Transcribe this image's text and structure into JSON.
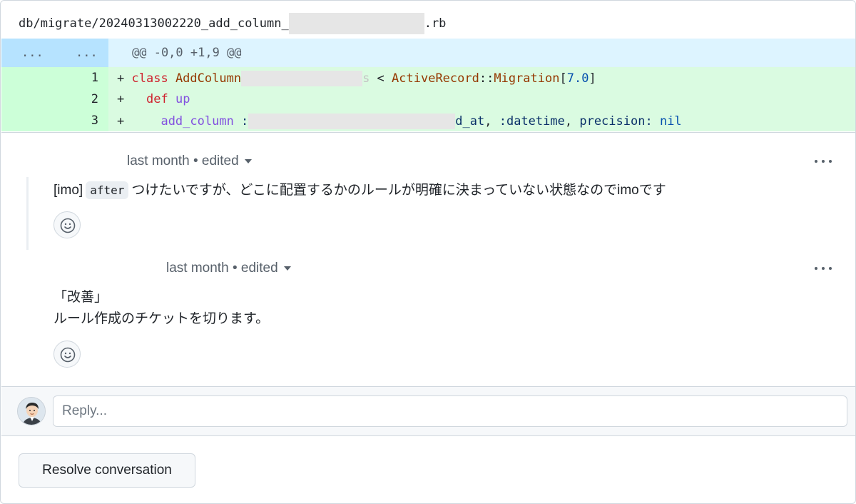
{
  "file": {
    "path_prefix": "db/migrate/20240313002220_add_column_",
    "path_suffix": ".rb"
  },
  "diff": {
    "hunk_left": "...",
    "hunk_right": "...",
    "hunk_header": "@@ -0,0 +1,9 @@",
    "lines": [
      {
        "num": "1",
        "plus": "+",
        "kw": "class",
        "cls": "AddColumn",
        "tail_ch": "s",
        "lt": " < ",
        "parent": "ActiveRecord",
        "sep": "::",
        "mig": "Migration",
        "lb": "[",
        "ver": "7.0",
        "rb": "]"
      },
      {
        "num": "2",
        "plus": "+",
        "indent": "  ",
        "kw": "def",
        "fn": "up"
      },
      {
        "num": "3",
        "plus": "+",
        "indent": "    ",
        "fn": "add_column",
        "sym_start": " :",
        "sym_end": "d_at",
        "comma1": ", ",
        "sym2": ":datetime",
        "comma2": ", ",
        "key": "precision:",
        "space": " ",
        "val": "nil"
      }
    ]
  },
  "comments": [
    {
      "time": "last month",
      "dot": "•",
      "edited": "edited",
      "tag": "[imo]",
      "code": "after",
      "text": "つけたいですが、どこに配置するかのルールが明確に決まっていない状態なのでimoです"
    },
    {
      "time": "last month",
      "dot": "•",
      "edited": "edited",
      "line1": "「改善」",
      "line2": "ルール作成のチケットを切ります。"
    }
  ],
  "reply": {
    "placeholder": "Reply..."
  },
  "actions": {
    "resolve_label": "Resolve conversation"
  },
  "colors": {
    "hunk_bg": "#ddf4ff",
    "add_bg": "#dafbe1",
    "add_gutter": "#ccffd8",
    "keyword": "#cf222e",
    "class_name": "#953800"
  },
  "icons": [
    "kebab-horizontal-icon",
    "smiley-icon",
    "chevron-down-icon",
    "avatar"
  ]
}
